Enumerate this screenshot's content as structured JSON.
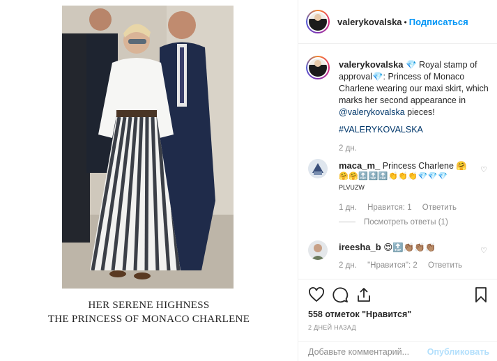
{
  "post": {
    "caption_line1": "HER SERENE HIGHNESS",
    "caption_line2": "THE PRINCESS OF MONACO CHARLENE"
  },
  "header": {
    "username": "valerykovalska",
    "separator": "•",
    "follow_label": "Подписаться"
  },
  "main_comment": {
    "username": "valerykovalska",
    "text_part1": "💎 Royal stamp of approval💎: Princess of Monaco Charlene wearing our maxi skirt, which marks her second appearance in ",
    "mention": "@valerykovalska",
    "text_part2": " pieces!",
    "hashtag": "#VALERYKOVALSKA",
    "time": "2 дн."
  },
  "comments": [
    {
      "username": "maca_m_",
      "text": "Princess Charlene 🤗",
      "emoji_line": "🤗🤗🔝🔝🔝👏👏👏💎💎💎",
      "extra_line": "PLVUZW",
      "time": "1 дн.",
      "likes": "Нравится: 1",
      "reply": "Ответить",
      "view_replies": "Посмотреть ответы (1)"
    },
    {
      "username": "ireesha_b",
      "text": "😍🔝👏🏽👏🏽👏🏽",
      "time": "2 дн.",
      "likes": "\"Нравится\": 2",
      "reply": "Ответить"
    }
  ],
  "actions": {
    "likes_count": "558 отметок \"Нравится\"",
    "date": "2 ДНЕЙ НАЗАД"
  },
  "comment_box": {
    "placeholder": "Добавьте комментарий...",
    "publish_label": "Опубликовать"
  },
  "colors": {
    "accent": "#0095f6",
    "link": "#00376b",
    "muted": "#8e8e8e",
    "publish_disabled": "#b2dffc"
  },
  "icons": [
    "heart-icon",
    "comment-icon",
    "share-icon",
    "bookmark-icon",
    "small-heart-icon",
    "emoji-icon"
  ]
}
